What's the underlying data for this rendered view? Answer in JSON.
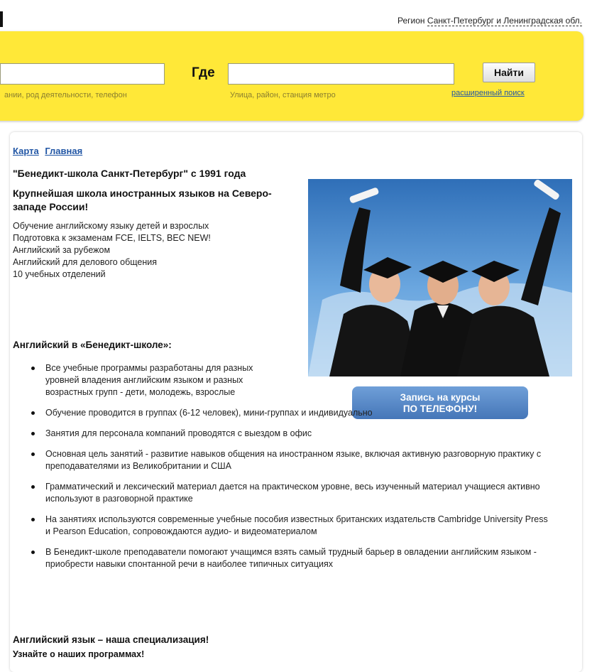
{
  "header": {
    "region_prefix": "Регион",
    "region_name": "Санкт-Петербург и Ленинградская обл."
  },
  "search": {
    "what_hint": "ании, род деятельности, телефон",
    "where_label": "Где",
    "where_hint": "Улица, район, станция метро",
    "find_label": "Найти",
    "advanced_link": "расширенный поиск"
  },
  "breadcrumb": [
    {
      "label": "Карта"
    },
    {
      "label": "Главная"
    }
  ],
  "company": {
    "title": "\"Бенедикт-школа Санкт-Петербург\" с 1991 года",
    "subtitle": "Крупнейшая школа иностранных языков на Северо-западе России!",
    "intro_lines": [
      "Обучение английскому языку детей и взрослых",
      "Подготовка к экзаменам FCE, IELTS, BEC NEW!",
      "Английский за рубежом",
      "Английский для делового общения",
      "10 учебных отделений"
    ]
  },
  "cta": {
    "line1": "Запись на курсы",
    "line2": "ПО ТЕЛЕФОНУ!"
  },
  "section": {
    "heading": "Английский в «Бенедикт-школе»:",
    "items": [
      "Все учебные программы разработаны для разных уровней владения английским языком и разных возрастных групп - дети, молодежь, взрослые",
      "Обучение проводится в группах (6-12 человек), мини-группах и индивидуально",
      "Занятия для персонала компаний проводятся с выездом в офис",
      "Основная цель занятий - развитие навыков общения на иностранном языке, включая активную разговорную практику с преподавателями из Великобритании и США",
      "Грамматический и лексический материал дается на практическом уровне, весь изученный материал учащиеся активно используют в разговорной практике",
      "На занятиях используются современные учебные пособия известных британских издательств Cambridge University Press и Pearson Education, сопровождаются аудио- и видеоматериалом",
      "В Бенедикт-школе преподаватели помогают учащимся взять самый трудный барьер в овладении английским языком - приобрести навыки спонтанной речи в наиболее типичных ситуациях"
    ]
  },
  "specialization": {
    "heading": "Английский язык – наша специализация!",
    "next_line": "Узнайте о наших программах!"
  }
}
